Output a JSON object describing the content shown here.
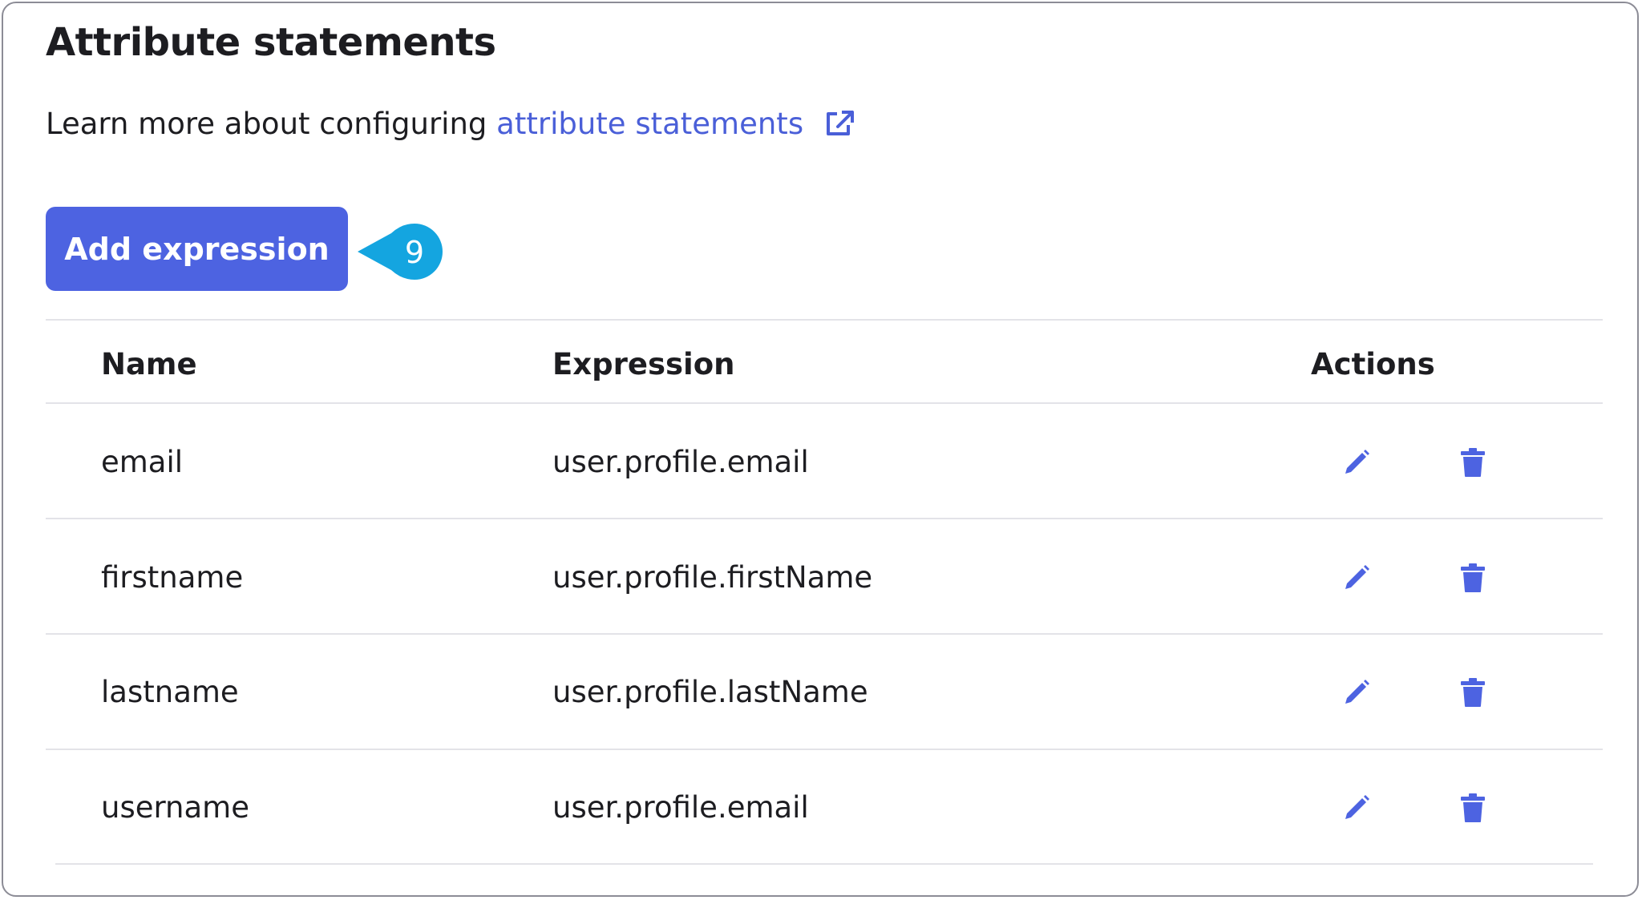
{
  "section": {
    "title": "Attribute statements",
    "learn_more_prefix": "Learn more about configuring",
    "learn_more_link": "attribute statements"
  },
  "add_button_label": "Add expression",
  "callout_number": "9",
  "table": {
    "headers": {
      "name": "Name",
      "expression": "Expression",
      "actions": "Actions"
    },
    "rows": [
      {
        "name": "email",
        "expression": "user.profile.email"
      },
      {
        "name": "firstname",
        "expression": "user.profile.firstName"
      },
      {
        "name": "lastname",
        "expression": "user.profile.lastName"
      },
      {
        "name": "username",
        "expression": "user.profile.email"
      }
    ]
  },
  "icons": {
    "external_link": "external-link-icon",
    "edit": "pencil-icon",
    "delete": "trash-icon"
  },
  "colors": {
    "accent": "#4d63e1",
    "link": "#4a5fd8",
    "callout": "#14a5e0",
    "text": "#1d1d21",
    "divider": "#e3e3e8"
  }
}
